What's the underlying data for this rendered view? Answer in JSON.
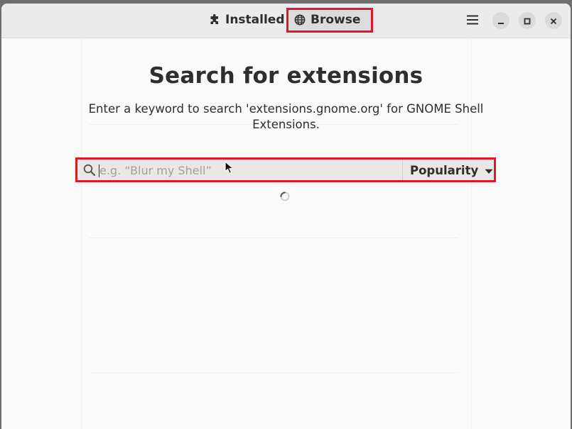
{
  "header": {
    "tabs": [
      {
        "label": "Installed",
        "icon": "puzzle-piece-icon",
        "active": false
      },
      {
        "label": "Browse",
        "icon": "globe-icon",
        "active": true
      }
    ],
    "menu_icon": "hamburger-menu-icon",
    "window_controls": [
      "minimize-icon",
      "maximize-icon",
      "close-icon"
    ]
  },
  "main": {
    "title": "Search for extensions",
    "subtitle": "Enter a keyword to search 'extensions.gnome.org' for GNOME Shell Extensions.",
    "search": {
      "placeholder": "e.g. “Blur my Shell”",
      "value": ""
    },
    "sort": {
      "selected": "Popularity"
    },
    "loading": true
  },
  "colors": {
    "highlight": "#e0192a",
    "text": "#2e2e2e",
    "window_bg": "#fafafa",
    "header_bg": "#ebebeb",
    "search_bg": "#e8e8e8"
  }
}
